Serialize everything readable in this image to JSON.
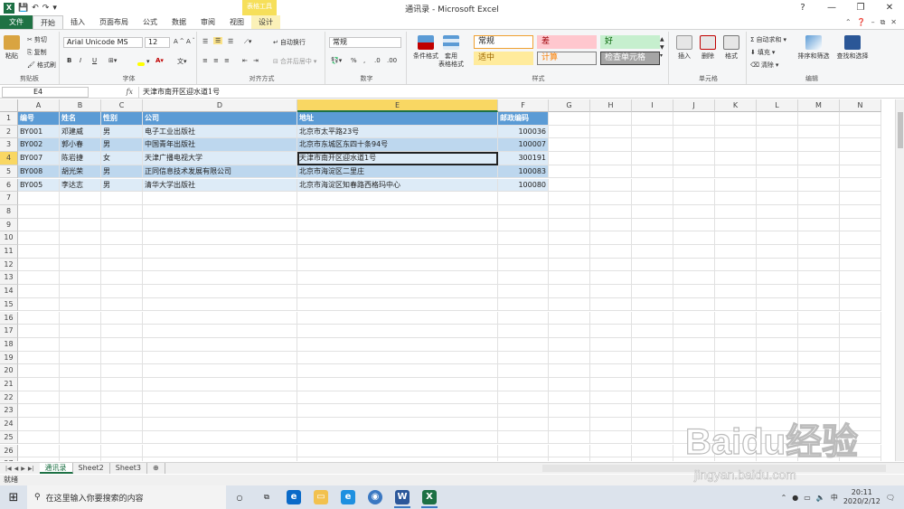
{
  "window": {
    "title": "通讯录 - Microsoft Excel",
    "contextual_tab_title": "表格工具",
    "quick_access": [
      "save",
      "undo",
      "redo"
    ],
    "controls": [
      "minimize",
      "restore",
      "close"
    ]
  },
  "ribbon_tabs": [
    "文件",
    "开始",
    "插入",
    "页面布局",
    "公式",
    "数据",
    "审阅",
    "视图",
    "设计"
  ],
  "ribbon": {
    "clipboard": {
      "label": "剪贴板",
      "paste": "粘贴",
      "cut": "剪切",
      "copy": "复制",
      "format_painter": "格式刷"
    },
    "font": {
      "label": "字体",
      "name": "Arial Unicode MS",
      "size": "12",
      "bold": "B",
      "italic": "I",
      "underline": "U"
    },
    "alignment": {
      "label": "对齐方式",
      "wrap": "自动换行",
      "merge": "合并后居中"
    },
    "number": {
      "label": "数字",
      "format": "常规",
      "percent": "%"
    },
    "styles": {
      "label": "样式",
      "conditional": "条件格式",
      "table_format": "套用\n表格格式",
      "cells": [
        {
          "text": "常规",
          "bg": "#ffffff",
          "fg": "#222222",
          "border": "#f0a030"
        },
        {
          "text": "差",
          "bg": "#ffc7ce",
          "fg": "#9c0006",
          "border": "#ffc7ce"
        },
        {
          "text": "好",
          "bg": "#c6efce",
          "fg": "#006100",
          "border": "#c6efce"
        },
        {
          "text": "适中",
          "bg": "#ffeb9c",
          "fg": "#9c6500",
          "border": "#ffeb9c"
        },
        {
          "text": "计算",
          "bg": "#f2f2f2",
          "fg": "#fa7d00",
          "border": "#7f7f7f"
        },
        {
          "text": "检查单元格",
          "bg": "#a5a5a5",
          "fg": "#ffffff",
          "border": "#3f3f3f"
        }
      ]
    },
    "cells_group": {
      "label": "单元格",
      "insert": "插入",
      "delete": "删除",
      "format": "格式"
    },
    "editing": {
      "label": "编辑",
      "autosum": "自动求和",
      "fill": "填充",
      "clear": "清除",
      "sort": "排序和筛选",
      "find": "查找和选择"
    }
  },
  "formula_bar": {
    "name_box": "E4",
    "fx": "fx",
    "content": "天津市南开区迎水道1号"
  },
  "columns": [
    "A",
    "B",
    "C",
    "D",
    "E",
    "F",
    "G",
    "H",
    "I",
    "J",
    "K",
    "L",
    "M",
    "N"
  ],
  "selected_column": "E",
  "selected_row": 4,
  "table": {
    "header": [
      "编号",
      "姓名",
      "性别",
      "公司",
      "地址",
      "邮政编码"
    ],
    "rows": [
      [
        "BY001",
        "邓建威",
        "男",
        "电子工业出版社",
        "北京市太平路23号",
        "100036"
      ],
      [
        "BY002",
        "郭小春",
        "男",
        "中国青年出版社",
        "北京市东城区东四十条94号",
        "100007"
      ],
      [
        "BY007",
        "陈岩捷",
        "女",
        "天津广播电视大学",
        "天津市南开区迎水道1号",
        "300191"
      ],
      [
        "BY008",
        "胡光荣",
        "男",
        "正同信息技术发展有限公司",
        "北京市海淀区二里庄",
        "100083"
      ],
      [
        "BY005",
        "李达志",
        "男",
        "清华大学出版社",
        "北京市海淀区知春路西格玛中心",
        "100080"
      ]
    ]
  },
  "row_count": 28,
  "sheets": [
    "通讯录",
    "Sheet2",
    "Sheet3"
  ],
  "active_sheet": "通讯录",
  "status": "就绪",
  "taskbar": {
    "search_placeholder": "在这里输入你要搜索的内容",
    "time": "20:11",
    "date": "2020/2/12"
  },
  "watermark_text": "Baidu经验",
  "watermark_sub": "jingyan.baidu.com"
}
